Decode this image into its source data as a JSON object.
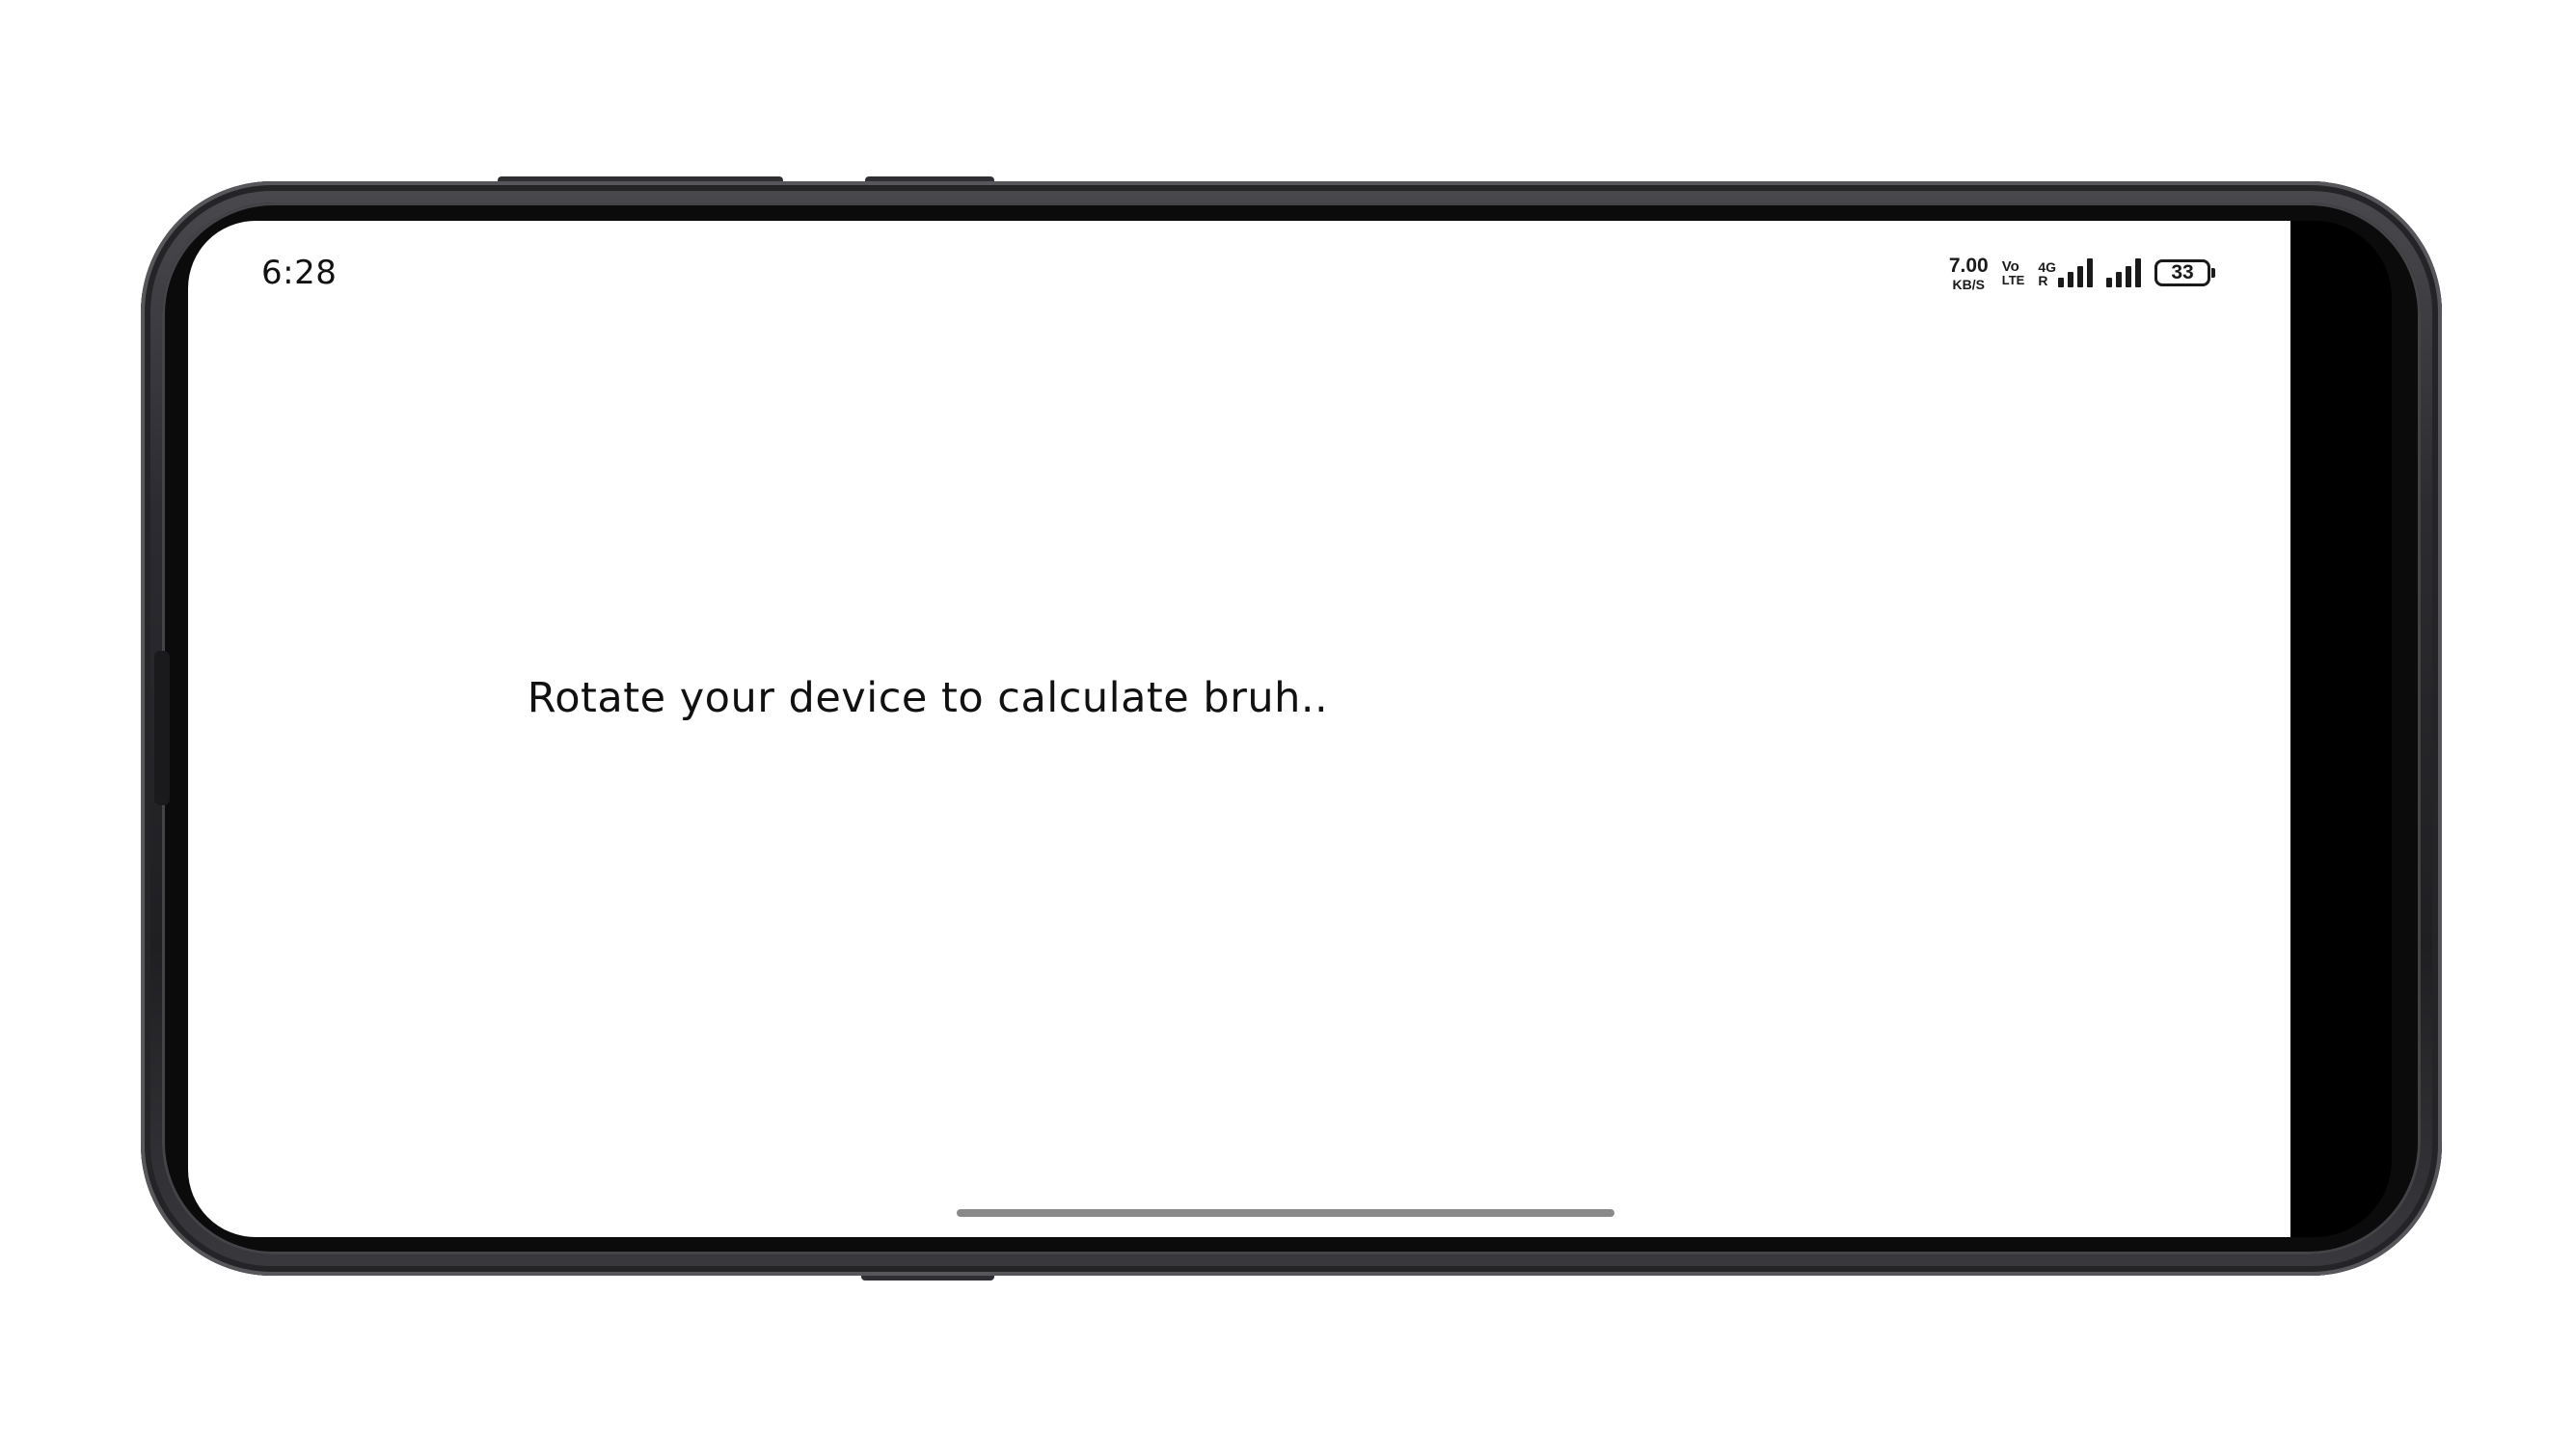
{
  "status_bar": {
    "time": "6:28",
    "speed_value": "7.00",
    "speed_unit": "KB/S",
    "volte_top": "Vo",
    "volte_bottom": "LTE",
    "network_type": "4G",
    "roaming": "R",
    "battery_level": "33"
  },
  "main": {
    "message": "Rotate your device to calculate bruh.."
  },
  "colors": {
    "frame": "#2c2c30",
    "screen_bg": "#ffffff",
    "text": "#111111",
    "home_indicator": "#8a8a8a"
  },
  "icons": [
    "signal-4g-icon",
    "signal-bars-icon",
    "battery-icon"
  ]
}
